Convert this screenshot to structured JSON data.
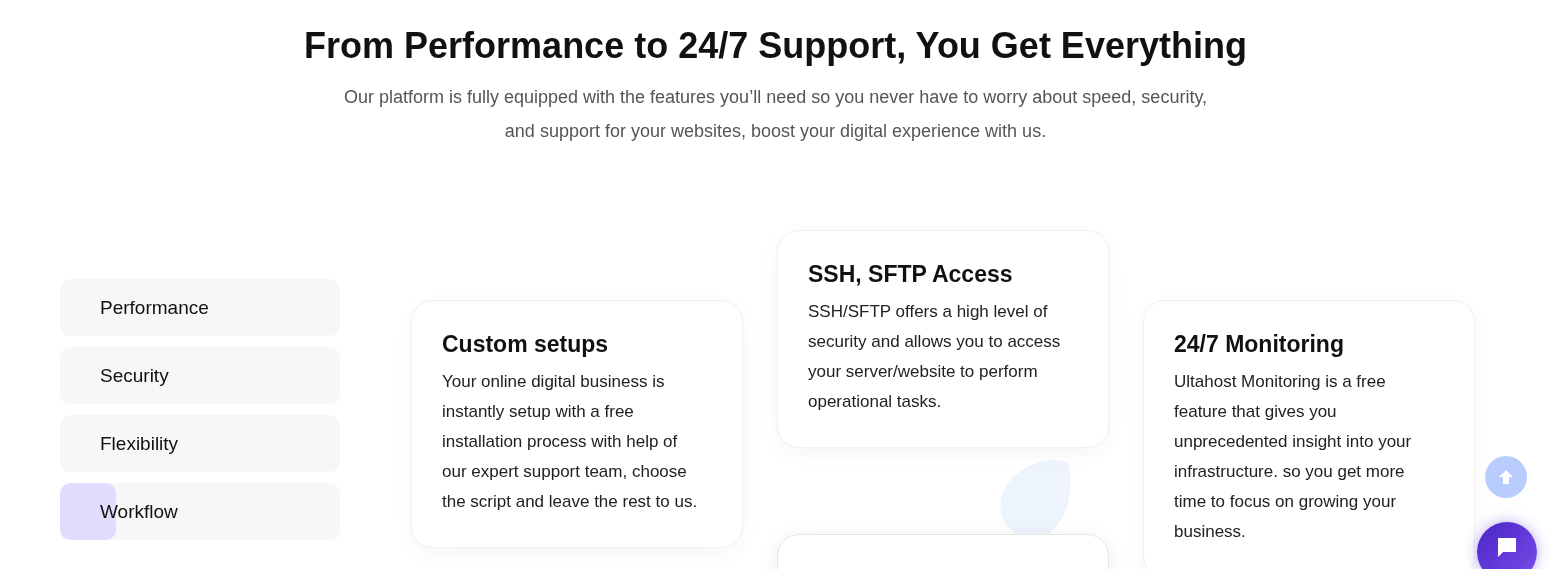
{
  "heading": "From Performance to 24/7 Support, You Get Everything",
  "intro": "Our platform is fully equipped with the features you’ll need so you never have to worry about speed, security, and support for your websites, boost your digital experience with us.",
  "tabs": [
    {
      "label": "Performance",
      "selected": false
    },
    {
      "label": "Security",
      "selected": false
    },
    {
      "label": "Flexibility",
      "selected": false
    },
    {
      "label": "Workflow",
      "selected": true,
      "level": 0.2
    }
  ],
  "columns": [
    [
      {
        "title": "Custom setups",
        "text": "Your online digital business is instantly setup with a free installation process with help of our expert support team, choose the script and leave the rest to us."
      }
    ],
    [
      {
        "title": "SSH, SFTP Access",
        "text": "SSH/SFTP offers a high level of security and allows you to access your server/website to perform operational tasks."
      },
      {
        "kind": "blank"
      }
    ],
    [
      {
        "title": "24/7 Monitoring",
        "text": "Ultahost Monitoring is a free feature that gives you unprecedented insight into your infrastructure. so you get more time to focus on growing your business."
      }
    ]
  ]
}
